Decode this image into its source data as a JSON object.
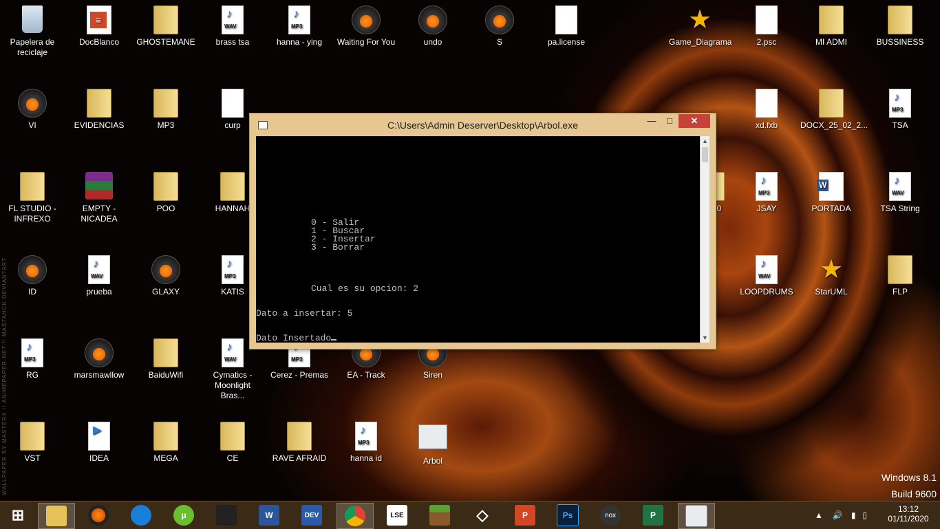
{
  "desktop": {
    "icons": [
      {
        "label": "Papelera de reciclaje",
        "icon": "recycle-bin-icon"
      },
      {
        "label": "DocBlanco",
        "icon": "pdf-icon"
      },
      {
        "label": "GHOSTEMANE",
        "icon": "folder-icon"
      },
      {
        "label": "brass tsa",
        "icon": "wav-file-icon"
      },
      {
        "label": "hanna - ying",
        "icon": "mp3-file-icon"
      },
      {
        "label": "Waiting For You",
        "icon": "fl-studio-icon"
      },
      {
        "label": "undo",
        "icon": "fl-studio-icon"
      },
      {
        "label": "S",
        "icon": "fl-studio-icon"
      },
      {
        "label": "pa.license",
        "icon": "file-icon"
      },
      {
        "label": "Game_Diagrama",
        "icon": "staruml-icon"
      },
      {
        "label": "2.psc",
        "icon": "file-icon"
      },
      {
        "label": "MI ADMI",
        "icon": "folder-icon"
      },
      {
        "label": "BUSSINESS",
        "icon": "folder-icon"
      },
      {
        "label": "VI",
        "icon": "fl-studio-icon"
      },
      {
        "label": "EVIDENCIAS",
        "icon": "folder-icon"
      },
      {
        "label": "MP3",
        "icon": "folder-icon"
      },
      {
        "label": "curp",
        "icon": "text-file-icon"
      },
      {
        "label": "xd.fxb",
        "icon": "file-icon"
      },
      {
        "label": "DOCX_25_02_2...",
        "icon": "folder-icon"
      },
      {
        "label": "TSA",
        "icon": "mp3-file-icon"
      },
      {
        "label": "FL STUDIO - INFREXO",
        "icon": "folder-icon"
      },
      {
        "label": "EMPTY - NICADEA",
        "icon": "winrar-icon"
      },
      {
        "label": "POO",
        "icon": "folder-icon"
      },
      {
        "label": "HANNAH",
        "icon": "folder-icon"
      },
      {
        "label": "2020",
        "icon": "folder-icon"
      },
      {
        "label": "JSAY",
        "icon": "mp3-file-icon"
      },
      {
        "label": "PORTADA",
        "icon": "word-doc-icon"
      },
      {
        "label": "TSA String",
        "icon": "wav-file-icon"
      },
      {
        "label": "ID",
        "icon": "fl-studio-icon"
      },
      {
        "label": "prueba",
        "icon": "wav-file-icon"
      },
      {
        "label": "GLAXY",
        "icon": "fl-studio-icon"
      },
      {
        "label": "KATIS",
        "icon": "mp3-file-icon"
      },
      {
        "label": "LOOPDRUMS",
        "icon": "wav-file-icon"
      },
      {
        "label": "StarUML",
        "icon": "staruml-icon"
      },
      {
        "label": "FLP",
        "icon": "folder-icon"
      },
      {
        "label": "RG",
        "icon": "mp3-file-icon"
      },
      {
        "label": "marsmawllow",
        "icon": "fl-studio-icon"
      },
      {
        "label": "BaiduWifi",
        "icon": "folder-icon"
      },
      {
        "label": "Cymatics - Moonlight Bras...",
        "icon": "wav-file-icon"
      },
      {
        "label": "Cerez - Premas",
        "icon": "mp3-file-icon"
      },
      {
        "label": "EA - Track",
        "icon": "fl-studio-icon"
      },
      {
        "label": "Siren",
        "icon": "fl-studio-icon"
      },
      {
        "label": "VST",
        "icon": "folder-icon"
      },
      {
        "label": "IDEA",
        "icon": "video-file-icon"
      },
      {
        "label": "MEGA",
        "icon": "folder-icon"
      },
      {
        "label": "CE",
        "icon": "folder-icon"
      },
      {
        "label": "RAVE AFRAID",
        "icon": "folder-icon"
      },
      {
        "label": "hanna id",
        "icon": "mp3-file-icon"
      },
      {
        "label": "Arbol",
        "icon": "app-window-icon"
      }
    ],
    "tags": {
      "wav": "WAV",
      "mp3": "MP3"
    },
    "watermark_left": "WALLPAPER BY MASTERX !! ANIMEPAPER.NET !! MASTAHCK.DEVIANTART",
    "os_name": "Windows 8.1",
    "os_build": "Build 9600"
  },
  "console": {
    "title": "C:\\Users\\Admin Deserver\\Desktop\\Arbol.exe",
    "menu": [
      "0 - Salir",
      "1 - Buscar",
      "2 - Insertar",
      "3 - Borrar"
    ],
    "prompt": "Cual es su opcion: 2",
    "insert_prompt": "Dato a insertar: 5",
    "result": "Dato Insertado"
  },
  "taskbar": {
    "apps": [
      "start",
      "file-explorer",
      "fl-studio",
      "proxifier",
      "utorrent",
      "steam",
      "word",
      "dev-cpp",
      "chrome",
      "lse",
      "minecraft",
      "unity",
      "powerpoint",
      "photoshop",
      "nox",
      "project",
      "arbol-console"
    ],
    "labels": {
      "dev": "DEV",
      "lse": "LSE",
      "ps": "Ps",
      "nox": "nox",
      "word": "W",
      "ppt": "P",
      "proj": "P"
    },
    "time": "13:12",
    "date": "01/11/2020"
  },
  "colors": {
    "console_frame": "#e6c792",
    "close_button": "#c7433a",
    "taskbar": "#3b2a15"
  }
}
